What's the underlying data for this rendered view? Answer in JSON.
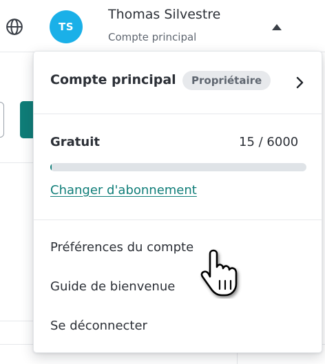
{
  "header": {
    "avatar_initials": "TS",
    "avatar_color": "#1ab0e8",
    "user_name": "Thomas Silvestre",
    "account_label": "Compte principal"
  },
  "menu": {
    "account": {
      "title": "Compte principal",
      "role_badge": "Propriétaire"
    },
    "plan": {
      "name": "Gratuit",
      "usage_text": "15 / 6000",
      "usage_fraction": 0.0025,
      "change_link": "Changer d'abonnement"
    },
    "items": [
      {
        "label": "Préférences du compte"
      },
      {
        "label": "Guide de bienvenue"
      },
      {
        "label": "Se déconnecter"
      }
    ]
  },
  "colors": {
    "accent": "#0f7d78",
    "badge_bg": "#e7e9ec",
    "text": "#2b2f36"
  }
}
